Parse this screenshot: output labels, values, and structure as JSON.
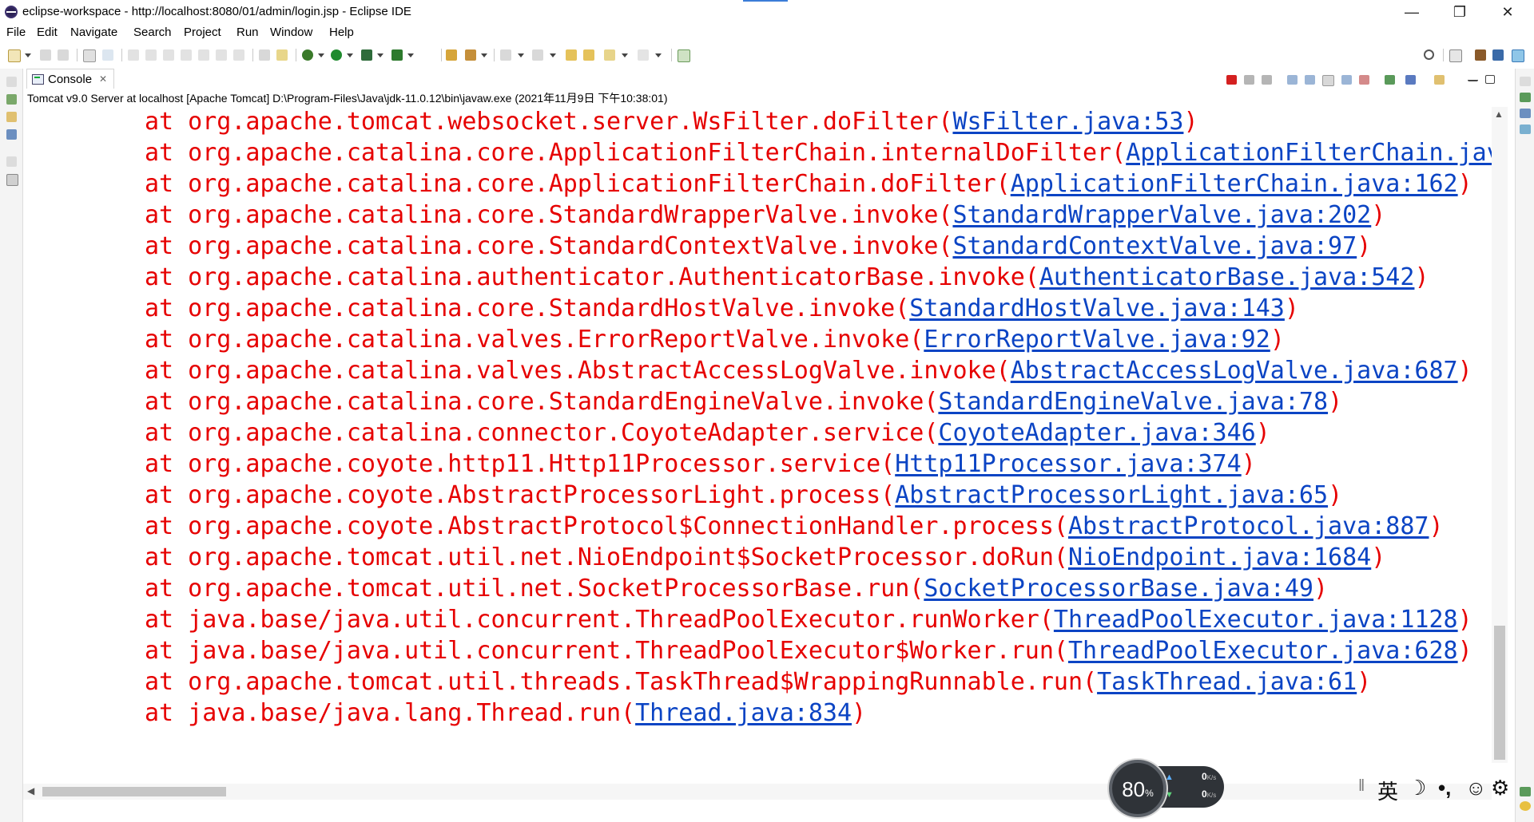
{
  "window": {
    "title": "eclipse-workspace - http://localhost:8080/01/admin/login.jsp - Eclipse IDE",
    "minimize_glyph": "—",
    "restore_glyph": "❐",
    "close_glyph": "✕"
  },
  "menu": {
    "items": [
      {
        "label": "File"
      },
      {
        "label": "Edit"
      },
      {
        "label": "Navigate"
      },
      {
        "label": "Search"
      },
      {
        "label": "Project"
      },
      {
        "label": "Run"
      },
      {
        "label": "Window"
      },
      {
        "label": "Help"
      }
    ]
  },
  "console": {
    "tab_label": "Console",
    "tab_close_glyph": "✕",
    "process_label": "Tomcat v9.0 Server at localhost [Apache Tomcat] D:\\Program-Files\\Java\\jdk-11.0.12\\bin\\javaw.exe  (2021年11月9日 下午10:38:01)",
    "lines": [
      {
        "prefix": "at org.apache.tomcat.websocket.server.WsFilter.doFilter(",
        "link": "WsFilter.java:53",
        "suffix": ")"
      },
      {
        "prefix": "at org.apache.catalina.core.ApplicationFilterChain.internalDoFilter(",
        "link": "ApplicationFilterChain.jav",
        "suffix": ""
      },
      {
        "prefix": "at org.apache.catalina.core.ApplicationFilterChain.doFilter(",
        "link": "ApplicationFilterChain.java:162",
        "suffix": ")"
      },
      {
        "prefix": "at org.apache.catalina.core.StandardWrapperValve.invoke(",
        "link": "StandardWrapperValve.java:202",
        "suffix": ")"
      },
      {
        "prefix": "at org.apache.catalina.core.StandardContextValve.invoke(",
        "link": "StandardContextValve.java:97",
        "suffix": ")"
      },
      {
        "prefix": "at org.apache.catalina.authenticator.AuthenticatorBase.invoke(",
        "link": "AuthenticatorBase.java:542",
        "suffix": ")"
      },
      {
        "prefix": "at org.apache.catalina.core.StandardHostValve.invoke(",
        "link": "StandardHostValve.java:143",
        "suffix": ")"
      },
      {
        "prefix": "at org.apache.catalina.valves.ErrorReportValve.invoke(",
        "link": "ErrorReportValve.java:92",
        "suffix": ")"
      },
      {
        "prefix": "at org.apache.catalina.valves.AbstractAccessLogValve.invoke(",
        "link": "AbstractAccessLogValve.java:687",
        "suffix": ")"
      },
      {
        "prefix": "at org.apache.catalina.core.StandardEngineValve.invoke(",
        "link": "StandardEngineValve.java:78",
        "suffix": ")"
      },
      {
        "prefix": "at org.apache.catalina.connector.CoyoteAdapter.service(",
        "link": "CoyoteAdapter.java:346",
        "suffix": ")"
      },
      {
        "prefix": "at org.apache.coyote.http11.Http11Processor.service(",
        "link": "Http11Processor.java:374",
        "suffix": ")"
      },
      {
        "prefix": "at org.apache.coyote.AbstractProcessorLight.process(",
        "link": "AbstractProcessorLight.java:65",
        "suffix": ")"
      },
      {
        "prefix": "at org.apache.coyote.AbstractProtocol$ConnectionHandler.process(",
        "link": "AbstractProtocol.java:887",
        "suffix": ")"
      },
      {
        "prefix": "at org.apache.tomcat.util.net.NioEndpoint$SocketProcessor.doRun(",
        "link": "NioEndpoint.java:1684",
        "suffix": ")"
      },
      {
        "prefix": "at org.apache.tomcat.util.net.SocketProcessorBase.run(",
        "link": "SocketProcessorBase.java:49",
        "suffix": ")"
      },
      {
        "prefix": "at java.base/java.util.concurrent.ThreadPoolExecutor.runWorker(",
        "link": "ThreadPoolExecutor.java:1128",
        "suffix": ")"
      },
      {
        "prefix": "at java.base/java.util.concurrent.ThreadPoolExecutor$Worker.run(",
        "link": "ThreadPoolExecutor.java:628",
        "suffix": ")"
      },
      {
        "prefix": "at org.apache.tomcat.util.threads.TaskThread$WrappingRunnable.run(",
        "link": "TaskThread.java:61",
        "suffix": ")"
      },
      {
        "prefix": "at java.base/java.lang.Thread.run(",
        "link": "Thread.java:834",
        "suffix": ")"
      }
    ],
    "colors": {
      "stderr": "#e60000",
      "link": "#0b44c4"
    }
  },
  "network_monitor": {
    "percent": "80",
    "percent_unit": "%",
    "upload_value": "0",
    "download_value": "0",
    "rate_unit": "K/s"
  },
  "ime": {
    "mode_label": "英",
    "moon_glyph": "☽",
    "punct_glyph": "•,",
    "emoji_glyph": "☺",
    "settings_glyph": "⚙"
  }
}
